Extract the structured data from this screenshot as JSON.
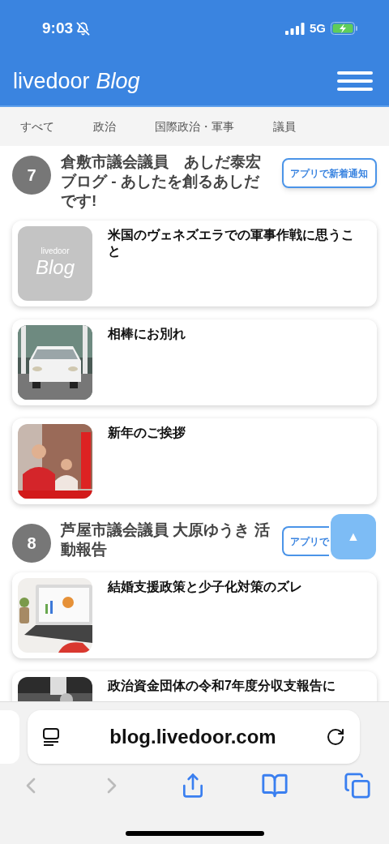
{
  "status_bar": {
    "time": "9:03",
    "network": "5G"
  },
  "header": {
    "logo_main": "livedoor",
    "logo_accent": "Blog"
  },
  "tabs": [
    {
      "label": "すべて",
      "selected": false
    },
    {
      "label": "政治",
      "selected": false
    },
    {
      "label": "国際政治・軍事",
      "selected": false
    },
    {
      "label": "議員",
      "selected": false
    }
  ],
  "sections": [
    {
      "rank": "7",
      "title": "倉敷市議会議員　あしだ泰宏ブログ - あしたを創るあしだです!",
      "notify_button": "アプリで新着通知",
      "posts": [
        {
          "title": "米国のヴェネズエラでの軍事作戦に思うこと",
          "thumb": {
            "kind": "placeholder",
            "line1": "livedoor",
            "line2": "Blog"
          }
        },
        {
          "title": "相棒にお別れ",
          "thumb": {
            "kind": "car"
          }
        },
        {
          "title": "新年のご挨拶",
          "thumb": {
            "kind": "speech"
          }
        }
      ]
    },
    {
      "rank": "8",
      "title": "芦屋市議会議員 大原ゆうき 活動報告",
      "notify_button": "アプリで",
      "posts": [
        {
          "title": "結婚支援政策と少子化対策のズレ",
          "thumb": {
            "kind": "laptop"
          }
        },
        {
          "title": "政治資金団体の令和7年度分収支報告に",
          "thumb": {
            "kind": "desk"
          }
        }
      ]
    }
  ],
  "scroll_top": {
    "label": "▲"
  },
  "browser": {
    "url": "blog.livedoor.com"
  }
}
